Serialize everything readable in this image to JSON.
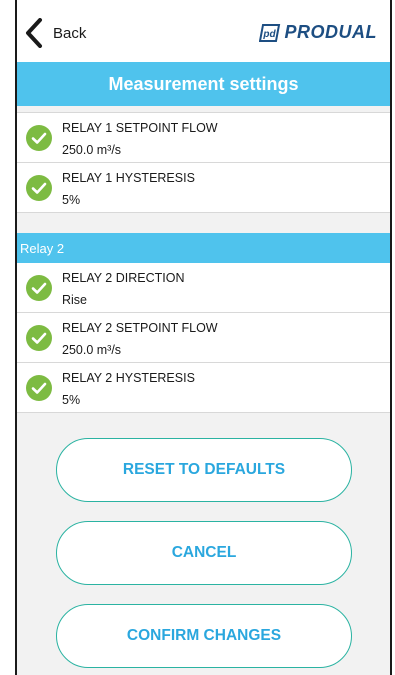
{
  "header": {
    "back_label": "Back",
    "logo_text": "PRODUAL",
    "logo_icon": "pd-logo-icon",
    "back_icon": "chevron-left-icon"
  },
  "titlebar": {
    "title": "Measurement settings"
  },
  "relay1_items": [
    {
      "label": "RELAY 1 SETPOINT FLOW",
      "value": "250.0 m³/s",
      "icon": "check-circle-icon"
    },
    {
      "label": "RELAY 1 HYSTERESIS",
      "value": "5%",
      "icon": "check-circle-icon"
    }
  ],
  "relay2": {
    "header": "Relay 2",
    "items": [
      {
        "label": "RELAY 2 DIRECTION",
        "value": "Rise",
        "icon": "check-circle-icon"
      },
      {
        "label": "RELAY 2 SETPOINT FLOW",
        "value": "250.0 m³/s",
        "icon": "check-circle-icon"
      },
      {
        "label": "RELAY 2 HYSTERESIS",
        "value": "5%",
        "icon": "check-circle-icon"
      }
    ]
  },
  "actions": {
    "reset_label": "RESET TO DEFAULTS",
    "cancel_label": "CANCEL",
    "confirm_label": "CONFIRM CHANGES"
  },
  "colors": {
    "accent_blue": "#4fc3ed",
    "check_green": "#7dbb42",
    "button_border": "#2bb3a2",
    "button_text": "#2aa7de",
    "logo_blue": "#1d4e82"
  }
}
